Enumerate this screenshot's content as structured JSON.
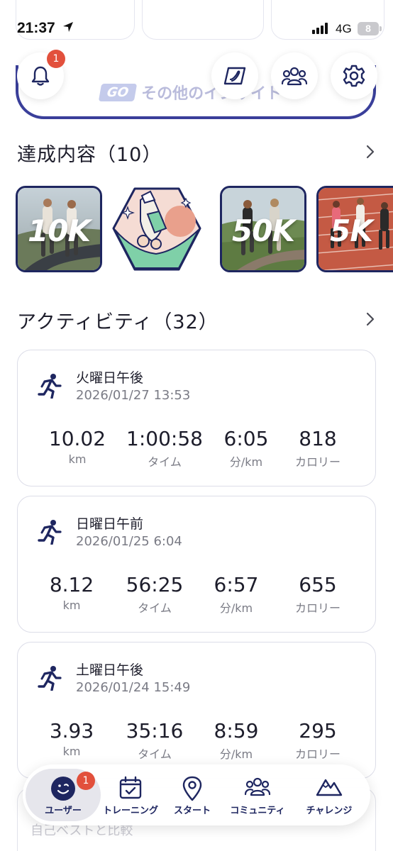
{
  "status_bar": {
    "time": "21:37",
    "network": "4G",
    "battery": "8"
  },
  "header": {
    "notification_count": "1",
    "insight_badge": "GO",
    "insight_text": "その他のインサイト"
  },
  "achievements": {
    "title": "達成内容",
    "count": "（10）",
    "items": [
      {
        "label": "10K"
      },
      {
        "label": ""
      },
      {
        "label": "50K"
      },
      {
        "label": "5K"
      }
    ]
  },
  "activity": {
    "title": "アクティビティ",
    "count": "（32）",
    "cards": [
      {
        "day": "火曜日午後",
        "date": "2026/01/27 13:53",
        "metrics": [
          {
            "value": "10.02",
            "unit": "km"
          },
          {
            "value": "1:00:58",
            "unit": "タイム"
          },
          {
            "value": "6:05",
            "unit": "分/km"
          },
          {
            "value": "818",
            "unit": "カロリー"
          }
        ]
      },
      {
        "day": "日曜日午前",
        "date": "2026/01/25 6:04",
        "metrics": [
          {
            "value": "8.12",
            "unit": "km"
          },
          {
            "value": "56:25",
            "unit": "タイム"
          },
          {
            "value": "6:57",
            "unit": "分/km"
          },
          {
            "value": "655",
            "unit": "カロリー"
          }
        ]
      },
      {
        "day": "土曜日午後",
        "date": "2026/01/24 15:49",
        "metrics": [
          {
            "value": "3.93",
            "unit": "km"
          },
          {
            "value": "35:16",
            "unit": "タイム"
          },
          {
            "value": "8:59",
            "unit": "分/km"
          },
          {
            "value": "295",
            "unit": "カロリー"
          }
        ]
      }
    ]
  },
  "peek": {
    "text": "自己ベストと比較"
  },
  "tabbar": {
    "user_badge": "1",
    "tabs": [
      {
        "label": "ユーザー",
        "icon": "user-face-icon"
      },
      {
        "label": "トレーニング",
        "icon": "calendar-icon"
      },
      {
        "label": "スタート",
        "icon": "location-pin-icon"
      },
      {
        "label": "コミュニティ",
        "icon": "community-icon"
      },
      {
        "label": "チャレンジ",
        "icon": "mountain-icon"
      }
    ]
  },
  "colors": {
    "brand_navy": "#1e2660",
    "badge_red": "#e2503c",
    "muted_text": "#7a7b85"
  }
}
